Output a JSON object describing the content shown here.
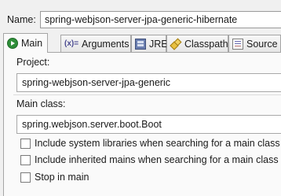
{
  "config": {
    "name_label": "Name:",
    "name_value": "spring-webjson-server-jpa-generic-hibernate"
  },
  "tabs": [
    {
      "label": "Main",
      "icon": "main-run-icon",
      "active": true
    },
    {
      "label": "Arguments",
      "icon": "arguments-icon",
      "icon_text": "(x)="
    },
    {
      "label": "JRE",
      "icon": "jre-library-icon"
    },
    {
      "label": "Classpath",
      "icon": "classpath-icon"
    },
    {
      "label": "Source",
      "icon": "source-icon"
    }
  ],
  "main": {
    "project_label": "Project:",
    "project_value": "spring-webjson-server-jpa-generic",
    "main_class_label": "Main class:",
    "main_class_value": "spring.webjson.server.boot.Boot",
    "checkboxes": [
      {
        "label": "Include system libraries when searching for a main class",
        "checked": false
      },
      {
        "label": "Include inherited mains when searching for a main class",
        "checked": false
      },
      {
        "label": "Stop in main",
        "checked": false
      }
    ]
  }
}
